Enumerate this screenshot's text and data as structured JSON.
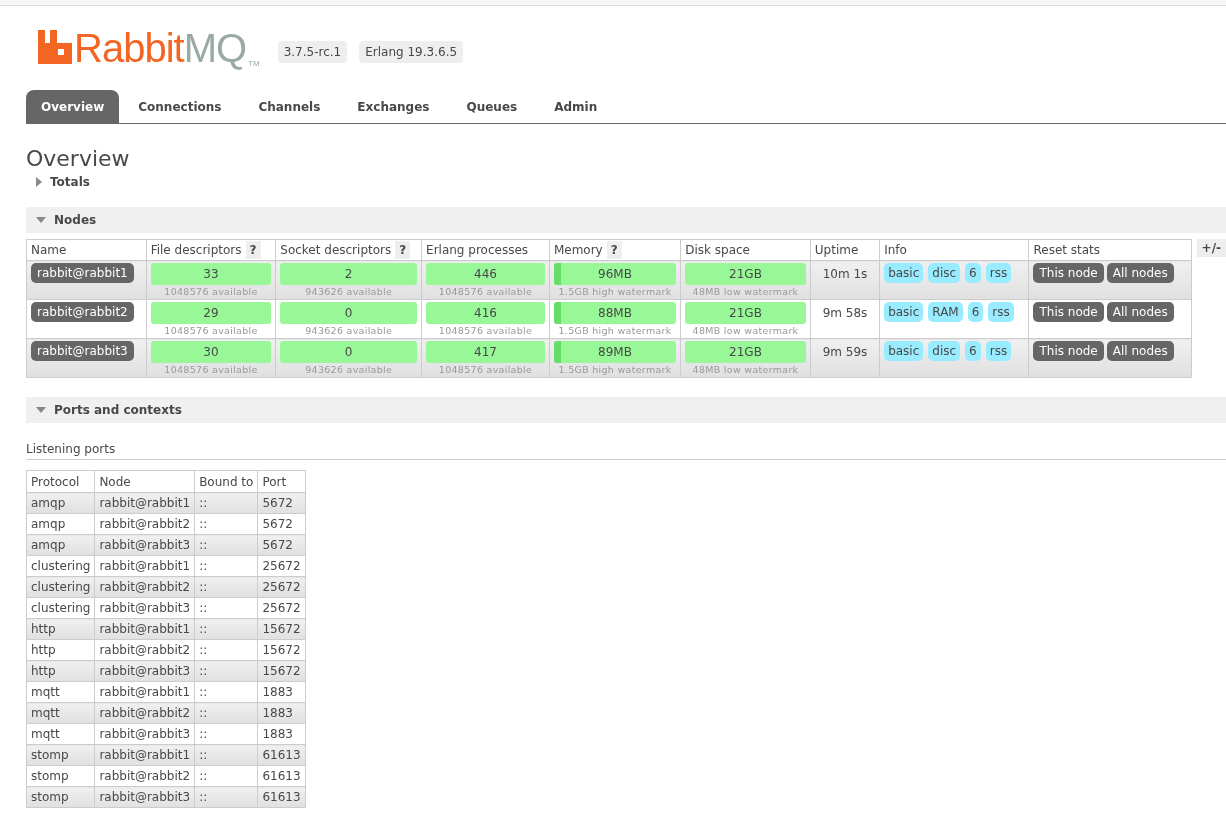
{
  "logo": {
    "name": "Rabbit",
    "suffix": "MQ",
    "tm": "TM"
  },
  "badges": [
    "3.7.5-rc.1",
    "Erlang 19.3.6.5"
  ],
  "tabs": [
    {
      "label": "Overview",
      "selected": true
    },
    {
      "label": "Connections",
      "selected": false
    },
    {
      "label": "Channels",
      "selected": false
    },
    {
      "label": "Exchanges",
      "selected": false
    },
    {
      "label": "Queues",
      "selected": false
    },
    {
      "label": "Admin",
      "selected": false
    }
  ],
  "page_title": "Overview",
  "totals": {
    "title": "Totals",
    "expanded": false
  },
  "nodes": {
    "title": "Nodes",
    "expanded": true,
    "columns": [
      {
        "label": "Name"
      },
      {
        "label": "File descriptors",
        "help": "?"
      },
      {
        "label": "Socket descriptors",
        "help": "?"
      },
      {
        "label": "Erlang processes"
      },
      {
        "label": "Memory",
        "help": "?"
      },
      {
        "label": "Disk space"
      },
      {
        "label": "Uptime"
      },
      {
        "label": "Info"
      },
      {
        "label": "Reset stats"
      }
    ],
    "toggle": "+/-",
    "rows": [
      {
        "name": "rabbit@rabbit1",
        "stats": [
          {
            "value": "33",
            "note": "1048576 available"
          },
          {
            "value": "2",
            "note": "943626 available"
          },
          {
            "value": "446",
            "note": "1048576 available"
          },
          {
            "value": "96MB",
            "note": "1.5GB high watermark",
            "level": 0.06
          },
          {
            "value": "21GB",
            "note": "48MB low watermark"
          }
        ],
        "uptime": "10m 1s",
        "info": [
          "basic",
          "disc",
          "6",
          "rss"
        ],
        "reset": [
          "This node",
          "All nodes"
        ]
      },
      {
        "name": "rabbit@rabbit2",
        "stats": [
          {
            "value": "29",
            "note": "1048576 available"
          },
          {
            "value": "0",
            "note": "943626 available"
          },
          {
            "value": "416",
            "note": "1048576 available"
          },
          {
            "value": "88MB",
            "note": "1.5GB high watermark",
            "level": 0.06
          },
          {
            "value": "21GB",
            "note": "48MB low watermark"
          }
        ],
        "uptime": "9m 58s",
        "info": [
          "basic",
          "RAM",
          "6",
          "rss"
        ],
        "reset": [
          "This node",
          "All nodes"
        ]
      },
      {
        "name": "rabbit@rabbit3",
        "stats": [
          {
            "value": "30",
            "note": "1048576 available"
          },
          {
            "value": "0",
            "note": "943626 available"
          },
          {
            "value": "417",
            "note": "1048576 available"
          },
          {
            "value": "89MB",
            "note": "1.5GB high watermark",
            "level": 0.06
          },
          {
            "value": "21GB",
            "note": "48MB low watermark"
          }
        ],
        "uptime": "9m 59s",
        "info": [
          "basic",
          "disc",
          "6",
          "rss"
        ],
        "reset": [
          "This node",
          "All nodes"
        ]
      }
    ]
  },
  "ports": {
    "title": "Ports and contexts",
    "expanded": true,
    "subtitle": "Listening ports",
    "columns": [
      "Protocol",
      "Node",
      "Bound to",
      "Port"
    ],
    "rows": [
      [
        "amqp",
        "rabbit@rabbit1",
        "::",
        "5672"
      ],
      [
        "amqp",
        "rabbit@rabbit2",
        "::",
        "5672"
      ],
      [
        "amqp",
        "rabbit@rabbit3",
        "::",
        "5672"
      ],
      [
        "clustering",
        "rabbit@rabbit1",
        "::",
        "25672"
      ],
      [
        "clustering",
        "rabbit@rabbit2",
        "::",
        "25672"
      ],
      [
        "clustering",
        "rabbit@rabbit3",
        "::",
        "25672"
      ],
      [
        "http",
        "rabbit@rabbit1",
        "::",
        "15672"
      ],
      [
        "http",
        "rabbit@rabbit2",
        "::",
        "15672"
      ],
      [
        "http",
        "rabbit@rabbit3",
        "::",
        "15672"
      ],
      [
        "mqtt",
        "rabbit@rabbit1",
        "::",
        "1883"
      ],
      [
        "mqtt",
        "rabbit@rabbit2",
        "::",
        "1883"
      ],
      [
        "mqtt",
        "rabbit@rabbit3",
        "::",
        "1883"
      ],
      [
        "stomp",
        "rabbit@rabbit1",
        "::",
        "61613"
      ],
      [
        "stomp",
        "rabbit@rabbit2",
        "::",
        "61613"
      ],
      [
        "stomp",
        "rabbit@rabbit3",
        "::",
        "61613"
      ]
    ]
  }
}
